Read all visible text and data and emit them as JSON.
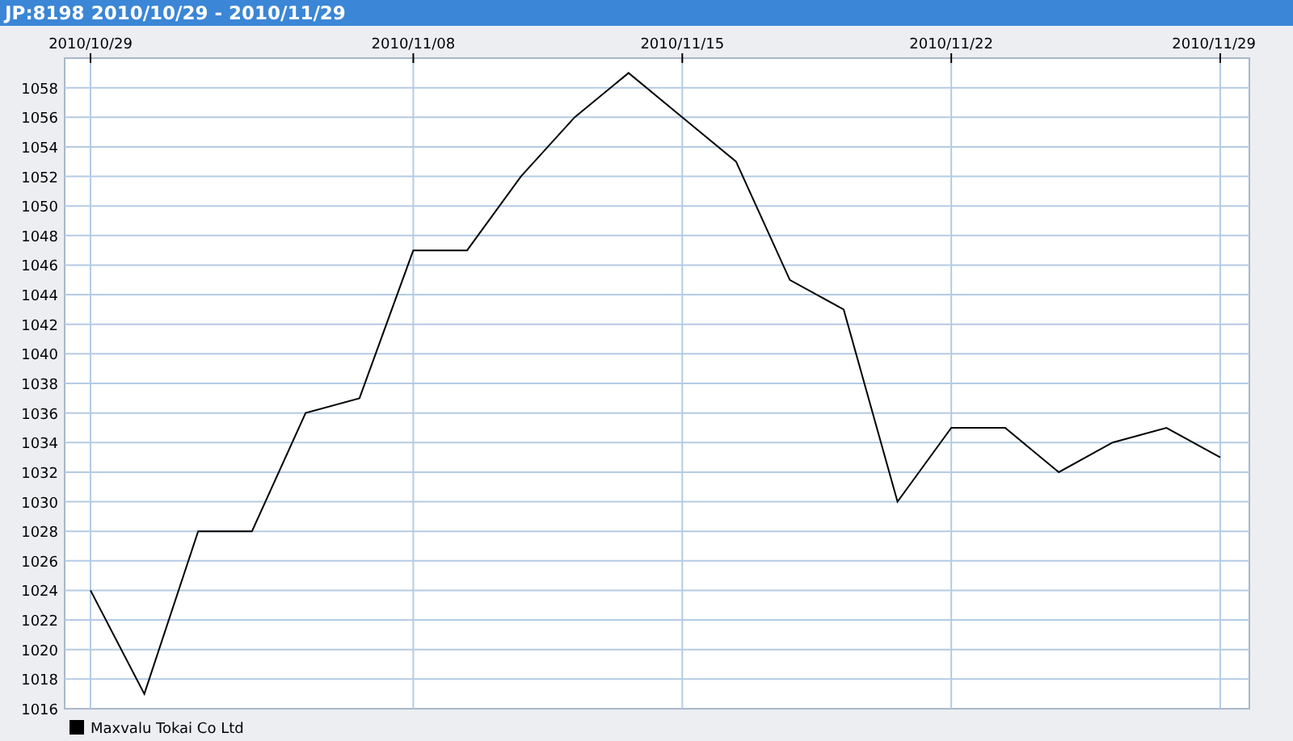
{
  "window": {
    "title": "JP:8198 2010/10/29 - 2010/11/29"
  },
  "chart_data": {
    "type": "line",
    "grid": true,
    "categories": [
      "2010/10/29",
      null,
      null,
      null,
      null,
      null,
      "2010/11/08",
      null,
      null,
      null,
      null,
      "2010/11/15",
      null,
      null,
      null,
      null,
      "2010/11/22",
      null,
      null,
      null,
      null,
      "2010/11/29"
    ],
    "series": [
      {
        "name": "Maxvalu Tokai Co Ltd",
        "color": "#000000",
        "values": [
          1024,
          1017,
          1028,
          1028,
          1036,
          1037,
          1047,
          1047,
          1052,
          1056,
          1059,
          1056,
          1053,
          1045,
          1043,
          1030,
          1035,
          1035,
          1032,
          1034,
          1035,
          1033
        ]
      }
    ],
    "ylim": [
      1016,
      1060
    ],
    "yticks": [
      1016,
      1018,
      1020,
      1022,
      1024,
      1026,
      1028,
      1030,
      1032,
      1034,
      1036,
      1038,
      1040,
      1042,
      1044,
      1046,
      1048,
      1050,
      1052,
      1054,
      1056,
      1058
    ]
  }
}
